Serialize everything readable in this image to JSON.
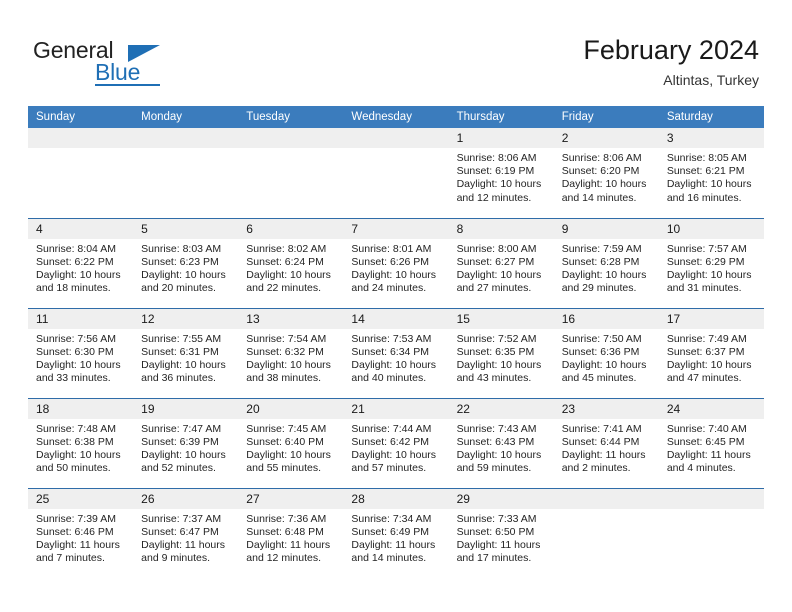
{
  "logo": {
    "word1": "General",
    "word2": "Blue",
    "triangle_color": "#1f6fb5"
  },
  "header": {
    "title": "February 2024",
    "subtitle": "Altintas, Turkey"
  },
  "theme": {
    "header_bg": "#3b7cbd",
    "row_divider": "#2f6ca8",
    "daynum_bg": "#efefef",
    "text": "#242424"
  },
  "weekdays": [
    "Sunday",
    "Monday",
    "Tuesday",
    "Wednesday",
    "Thursday",
    "Friday",
    "Saturday"
  ],
  "weeks": [
    [
      {
        "day": "",
        "lines": []
      },
      {
        "day": "",
        "lines": []
      },
      {
        "day": "",
        "lines": []
      },
      {
        "day": "",
        "lines": []
      },
      {
        "day": "1",
        "lines": [
          "Sunrise: 8:06 AM",
          "Sunset: 6:19 PM",
          "Daylight: 10 hours and 12 minutes."
        ]
      },
      {
        "day": "2",
        "lines": [
          "Sunrise: 8:06 AM",
          "Sunset: 6:20 PM",
          "Daylight: 10 hours and 14 minutes."
        ]
      },
      {
        "day": "3",
        "lines": [
          "Sunrise: 8:05 AM",
          "Sunset: 6:21 PM",
          "Daylight: 10 hours and 16 minutes."
        ]
      }
    ],
    [
      {
        "day": "4",
        "lines": [
          "Sunrise: 8:04 AM",
          "Sunset: 6:22 PM",
          "Daylight: 10 hours and 18 minutes."
        ]
      },
      {
        "day": "5",
        "lines": [
          "Sunrise: 8:03 AM",
          "Sunset: 6:23 PM",
          "Daylight: 10 hours and 20 minutes."
        ]
      },
      {
        "day": "6",
        "lines": [
          "Sunrise: 8:02 AM",
          "Sunset: 6:24 PM",
          "Daylight: 10 hours and 22 minutes."
        ]
      },
      {
        "day": "7",
        "lines": [
          "Sunrise: 8:01 AM",
          "Sunset: 6:26 PM",
          "Daylight: 10 hours and 24 minutes."
        ]
      },
      {
        "day": "8",
        "lines": [
          "Sunrise: 8:00 AM",
          "Sunset: 6:27 PM",
          "Daylight: 10 hours and 27 minutes."
        ]
      },
      {
        "day": "9",
        "lines": [
          "Sunrise: 7:59 AM",
          "Sunset: 6:28 PM",
          "Daylight: 10 hours and 29 minutes."
        ]
      },
      {
        "day": "10",
        "lines": [
          "Sunrise: 7:57 AM",
          "Sunset: 6:29 PM",
          "Daylight: 10 hours and 31 minutes."
        ]
      }
    ],
    [
      {
        "day": "11",
        "lines": [
          "Sunrise: 7:56 AM",
          "Sunset: 6:30 PM",
          "Daylight: 10 hours and 33 minutes."
        ]
      },
      {
        "day": "12",
        "lines": [
          "Sunrise: 7:55 AM",
          "Sunset: 6:31 PM",
          "Daylight: 10 hours and 36 minutes."
        ]
      },
      {
        "day": "13",
        "lines": [
          "Sunrise: 7:54 AM",
          "Sunset: 6:32 PM",
          "Daylight: 10 hours and 38 minutes."
        ]
      },
      {
        "day": "14",
        "lines": [
          "Sunrise: 7:53 AM",
          "Sunset: 6:34 PM",
          "Daylight: 10 hours and 40 minutes."
        ]
      },
      {
        "day": "15",
        "lines": [
          "Sunrise: 7:52 AM",
          "Sunset: 6:35 PM",
          "Daylight: 10 hours and 43 minutes."
        ]
      },
      {
        "day": "16",
        "lines": [
          "Sunrise: 7:50 AM",
          "Sunset: 6:36 PM",
          "Daylight: 10 hours and 45 minutes."
        ]
      },
      {
        "day": "17",
        "lines": [
          "Sunrise: 7:49 AM",
          "Sunset: 6:37 PM",
          "Daylight: 10 hours and 47 minutes."
        ]
      }
    ],
    [
      {
        "day": "18",
        "lines": [
          "Sunrise: 7:48 AM",
          "Sunset: 6:38 PM",
          "Daylight: 10 hours and 50 minutes."
        ]
      },
      {
        "day": "19",
        "lines": [
          "Sunrise: 7:47 AM",
          "Sunset: 6:39 PM",
          "Daylight: 10 hours and 52 minutes."
        ]
      },
      {
        "day": "20",
        "lines": [
          "Sunrise: 7:45 AM",
          "Sunset: 6:40 PM",
          "Daylight: 10 hours and 55 minutes."
        ]
      },
      {
        "day": "21",
        "lines": [
          "Sunrise: 7:44 AM",
          "Sunset: 6:42 PM",
          "Daylight: 10 hours and 57 minutes."
        ]
      },
      {
        "day": "22",
        "lines": [
          "Sunrise: 7:43 AM",
          "Sunset: 6:43 PM",
          "Daylight: 10 hours and 59 minutes."
        ]
      },
      {
        "day": "23",
        "lines": [
          "Sunrise: 7:41 AM",
          "Sunset: 6:44 PM",
          "Daylight: 11 hours and 2 minutes."
        ]
      },
      {
        "day": "24",
        "lines": [
          "Sunrise: 7:40 AM",
          "Sunset: 6:45 PM",
          "Daylight: 11 hours and 4 minutes."
        ]
      }
    ],
    [
      {
        "day": "25",
        "lines": [
          "Sunrise: 7:39 AM",
          "Sunset: 6:46 PM",
          "Daylight: 11 hours and 7 minutes."
        ]
      },
      {
        "day": "26",
        "lines": [
          "Sunrise: 7:37 AM",
          "Sunset: 6:47 PM",
          "Daylight: 11 hours and 9 minutes."
        ]
      },
      {
        "day": "27",
        "lines": [
          "Sunrise: 7:36 AM",
          "Sunset: 6:48 PM",
          "Daylight: 11 hours and 12 minutes."
        ]
      },
      {
        "day": "28",
        "lines": [
          "Sunrise: 7:34 AM",
          "Sunset: 6:49 PM",
          "Daylight: 11 hours and 14 minutes."
        ]
      },
      {
        "day": "29",
        "lines": [
          "Sunrise: 7:33 AM",
          "Sunset: 6:50 PM",
          "Daylight: 11 hours and 17 minutes."
        ]
      },
      {
        "day": "",
        "lines": []
      },
      {
        "day": "",
        "lines": []
      }
    ]
  ]
}
